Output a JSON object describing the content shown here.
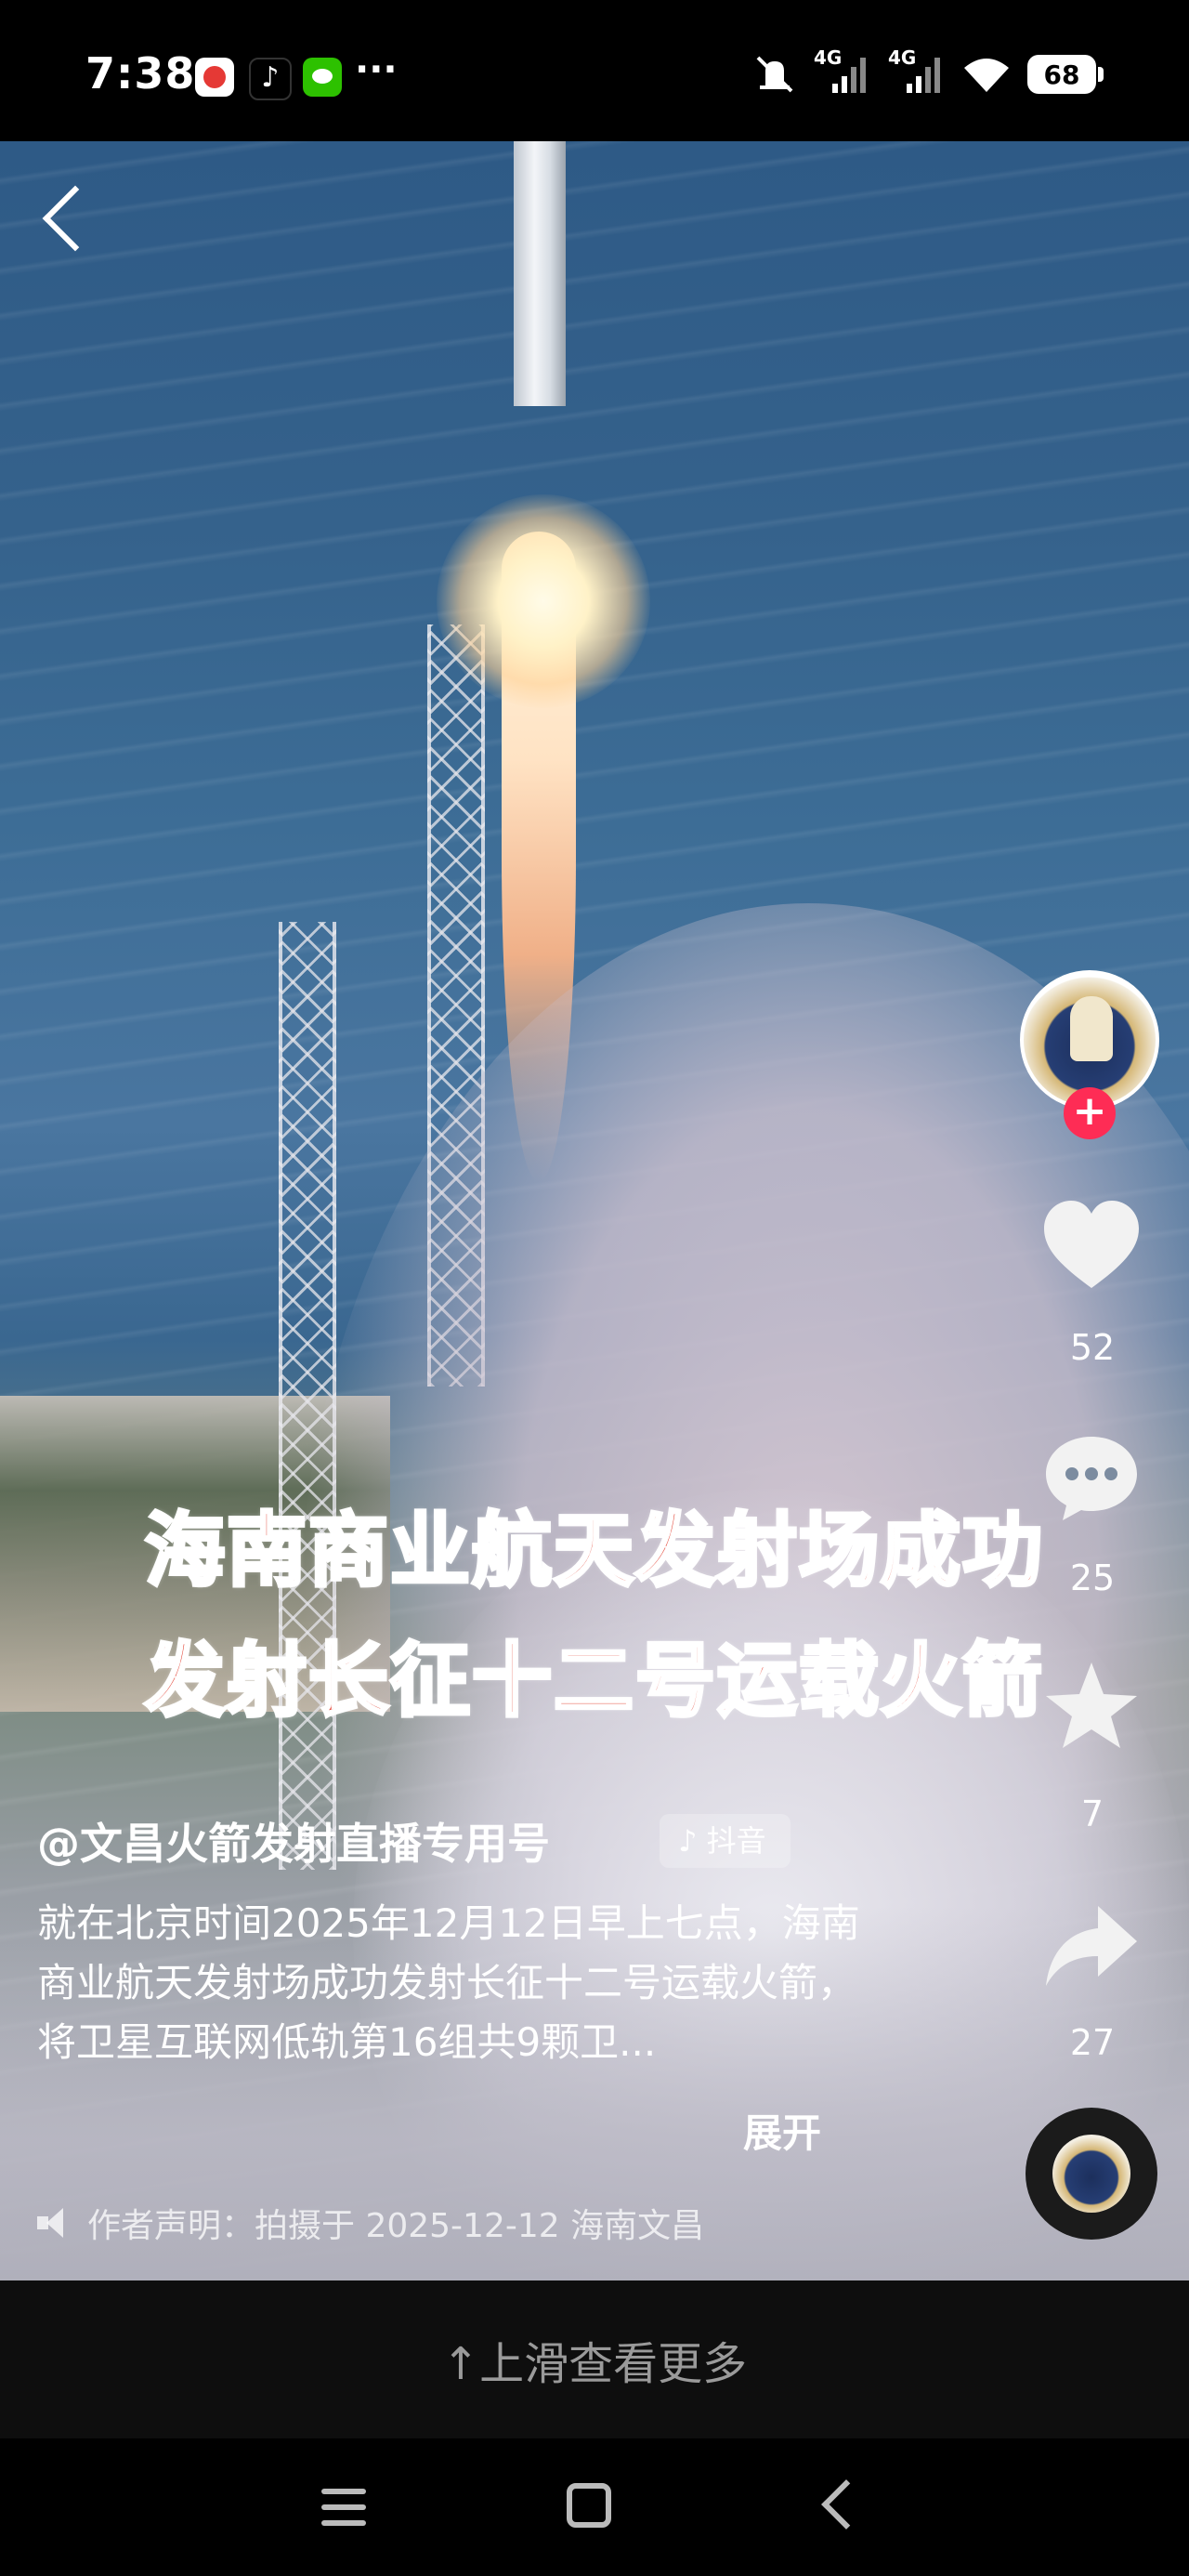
{
  "status_bar": {
    "time": "7:38",
    "network_1": "4G",
    "network_2": "4G",
    "battery": "68",
    "more": "···"
  },
  "video": {
    "overlay_line_1": "海南商业航天发射场成功",
    "overlay_line_2": "发射长征十二号运载火箭"
  },
  "actions": {
    "likes": "52",
    "comments": "25",
    "favorites": "7",
    "shares": "27",
    "follow": "+"
  },
  "caption": {
    "author": "@文昌火箭发射直播专用号",
    "tag": "♪ 抖音",
    "description": "就在北京时间2025年12月12日早上七点，海南商业航天发射场成功发射长征十二号运载火箭，将卫星互联网低轨第16组共9颗卫...",
    "expand": "展开",
    "statement": "作者声明：拍摄于 2025-12-12 海南文昌"
  },
  "bottom": {
    "swipe_hint": "↑上滑查看更多"
  },
  "colors": {
    "overlay_text": "#e23a2a",
    "follow_badge": "#fe2c55"
  }
}
